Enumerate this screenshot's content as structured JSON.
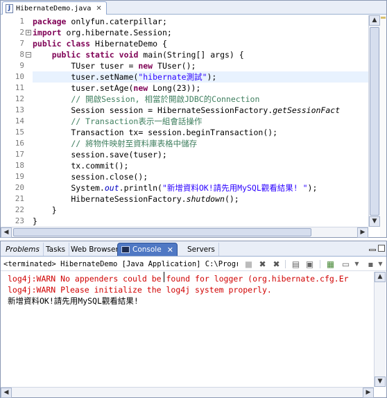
{
  "editor": {
    "tab_title": "HibernateDemo.java",
    "tab_icon": "java-file-icon",
    "close_glyph": "✕",
    "line_numbers": [
      "1",
      "2",
      "7",
      "8",
      "9",
      "10",
      "11",
      "12",
      "13",
      "14",
      "15",
      "16",
      "17",
      "18",
      "19",
      "20",
      "21",
      "22",
      "23"
    ],
    "current_line": "10",
    "fold_markers": {
      "2": "+",
      "8": "−"
    }
  },
  "code_lines": [
    [
      {
        "t": "package",
        "c": "kw"
      },
      {
        "t": " onlyfun.caterpillar;"
      }
    ],
    [
      {
        "t": "import",
        "c": "kw"
      },
      {
        "t": " org.hibernate.Session;"
      }
    ],
    [
      {
        "t": "public",
        "c": "kw"
      },
      {
        "t": " "
      },
      {
        "t": "class",
        "c": "kw"
      },
      {
        "t": " HibernateDemo {"
      }
    ],
    [
      {
        "t": "    "
      },
      {
        "t": "public",
        "c": "kw"
      },
      {
        "t": " "
      },
      {
        "t": "static",
        "c": "kw"
      },
      {
        "t": " "
      },
      {
        "t": "void",
        "c": "kw"
      },
      {
        "t": " main(String[] args) {"
      }
    ],
    [
      {
        "t": "        TUser tuser = "
      },
      {
        "t": "new",
        "c": "kw"
      },
      {
        "t": " TUser();"
      }
    ],
    [
      {
        "t": "        tuser.setName("
      },
      {
        "t": "\"hibernate測試\"",
        "c": "str"
      },
      {
        "t": ");"
      }
    ],
    [
      {
        "t": "        tuser.setAge("
      },
      {
        "t": "new",
        "c": "kw"
      },
      {
        "t": " Long(23));"
      }
    ],
    [
      {
        "t": "        // 開啟Session, 相當於開啟JDBC的Connection",
        "c": "cm"
      }
    ],
    [
      {
        "t": "        Session session = HibernateSessionFactory."
      },
      {
        "t": "getSessionFact",
        "c": "it"
      }
    ],
    [
      {
        "t": "        // Transaction表示一組會話操作",
        "c": "cm"
      }
    ],
    [
      {
        "t": "        Transaction tx= session.beginTransaction();"
      }
    ],
    [
      {
        "t": "        // 將物件映射至資料庫表格中儲存",
        "c": "cm"
      }
    ],
    [
      {
        "t": "        session.save(tuser);"
      }
    ],
    [
      {
        "t": "        tx.commit();"
      }
    ],
    [
      {
        "t": "        session.close();"
      }
    ],
    [
      {
        "t": "        System."
      },
      {
        "t": "out",
        "c": "fld"
      },
      {
        "t": ".println("
      },
      {
        "t": "\"新增資料OK!請先用MySQL觀看結果! \"",
        "c": "str"
      },
      {
        "t": ");"
      }
    ],
    [
      {
        "t": "        HibernateSessionFactory."
      },
      {
        "t": "shutdown",
        "c": "it"
      },
      {
        "t": "();"
      }
    ],
    [
      {
        "t": "    }"
      }
    ],
    [
      {
        "t": "}"
      }
    ]
  ],
  "views": {
    "tabs": [
      {
        "label": "Problems",
        "italic": true
      },
      {
        "label": "Tasks"
      },
      {
        "label": "Web Browser"
      },
      {
        "label": "Console",
        "active": true
      },
      {
        "label": "Servers"
      }
    ]
  },
  "console": {
    "description": "<terminated> HibernateDemo [Java Application] C:\\Program Fi",
    "toolbar_icons": [
      "terminate-icon",
      "remove-launch-icon",
      "remove-all-terminated-icon",
      "scroll-lock-icon",
      "pin-console-icon",
      "open-console-icon",
      "display-selected-console-icon",
      "view-menu-icon"
    ],
    "lines": [
      {
        "text": "log4j:WARN No appenders could be found for logger (org.hibernate.cfg.Er",
        "kind": "err"
      },
      {
        "text": "log4j:WARN Please initialize the log4j system properly.",
        "kind": "err"
      },
      {
        "text": "新增資料OK!請先用MySQL觀看結果!",
        "kind": "std"
      }
    ]
  },
  "colors": {
    "keyword": "#7f0055",
    "string": "#2a00ff",
    "comment": "#3f7f5f",
    "error_output": "#d00000",
    "active_tab": "#4f78c4"
  }
}
